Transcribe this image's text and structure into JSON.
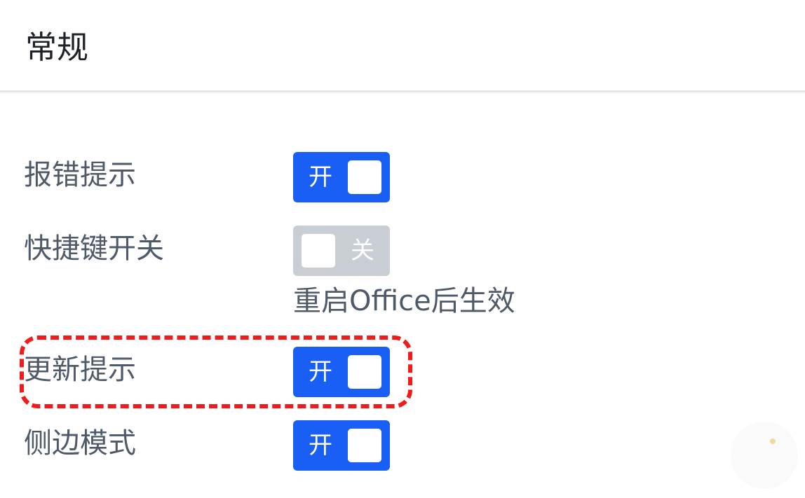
{
  "header": {
    "title": "常规"
  },
  "settings": [
    {
      "label": "报错提示",
      "state": "on",
      "state_text": "开"
    },
    {
      "label": "快捷键开关",
      "state": "off",
      "state_text": "关",
      "hint": "重启Office后生效"
    },
    {
      "label": "更新提示",
      "state": "on",
      "state_text": "开",
      "highlighted": true
    },
    {
      "label": "侧边模式",
      "state": "on",
      "state_text": "开"
    }
  ],
  "colors": {
    "switch_on": "#1a5ff5",
    "switch_off": "#c9cdd4",
    "highlight_border": "#ef1c1c",
    "label_text": "#4e5969",
    "title_text": "#1f2329"
  }
}
